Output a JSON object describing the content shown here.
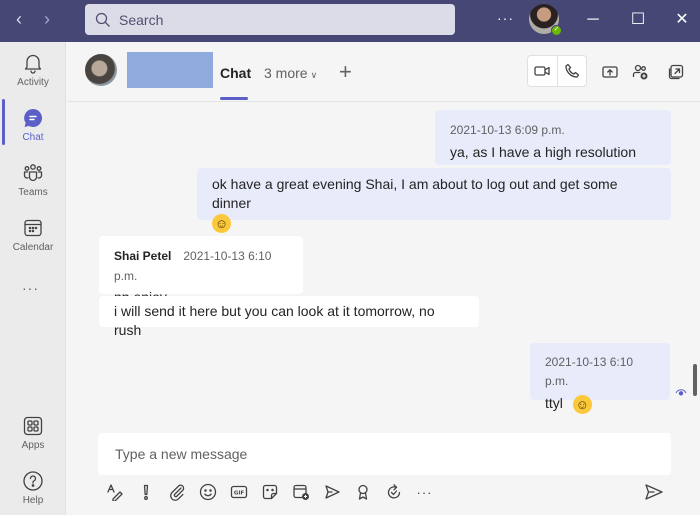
{
  "titlebar": {
    "search_placeholder": "Search",
    "more_label": "···",
    "user_status": "available",
    "window_controls": {
      "minimize": "─",
      "maximize": "☐",
      "close": "✕"
    },
    "nav": {
      "back": "‹",
      "forward": "›"
    }
  },
  "sidebar": {
    "items": [
      {
        "label": "Activity",
        "icon": "bell-icon"
      },
      {
        "label": "Chat",
        "icon": "chat-icon",
        "active": true
      },
      {
        "label": "Teams",
        "icon": "teams-icon"
      },
      {
        "label": "Calendar",
        "icon": "calendar-icon"
      }
    ],
    "more_label": "···",
    "bottom_items": [
      {
        "label": "Apps",
        "icon": "apps-icon"
      },
      {
        "label": "Help",
        "icon": "help-icon"
      }
    ],
    "accent_color": "#5b5fc7"
  },
  "chat_header": {
    "tabs": [
      {
        "label": "Chat",
        "active": true
      },
      {
        "label": "3 more"
      }
    ],
    "add_tab_label": "+",
    "actions": [
      "video-call",
      "audio-call",
      "share-screen",
      "add-people",
      "pop-out"
    ]
  },
  "messages": [
    {
      "from": "me",
      "timestamp": "2021-10-13 6:09 p.m.",
      "text": "ya, as I have a high resolution one"
    },
    {
      "from": "me",
      "text": "ok have a great evening Shai, I am about to log out and get some dinner",
      "emoji": "☺"
    },
    {
      "from": "them",
      "sender": "Shai Petel",
      "timestamp": "2021-10-13 6:10 p.m.",
      "text": "np enjoy"
    },
    {
      "from": "them",
      "text": "i will send it here but you can look at it tomorrow, no rush"
    },
    {
      "from": "me",
      "timestamp": "2021-10-13 6:10 p.m.",
      "text": "ttyl",
      "emoji": "☺"
    }
  ],
  "compose": {
    "placeholder": "Type a new message",
    "tools": [
      "format",
      "important",
      "attach",
      "emoji",
      "gif",
      "sticker",
      "schedule-meeting",
      "stream",
      "praise",
      "loop",
      "more"
    ],
    "more_label": "···"
  },
  "colors": {
    "titlebar": "#464775",
    "my_bubble": "#e8ebfa",
    "their_bubble": "#ffffff",
    "accent": "#5b5fc7",
    "presence_available": "#6bb700"
  }
}
